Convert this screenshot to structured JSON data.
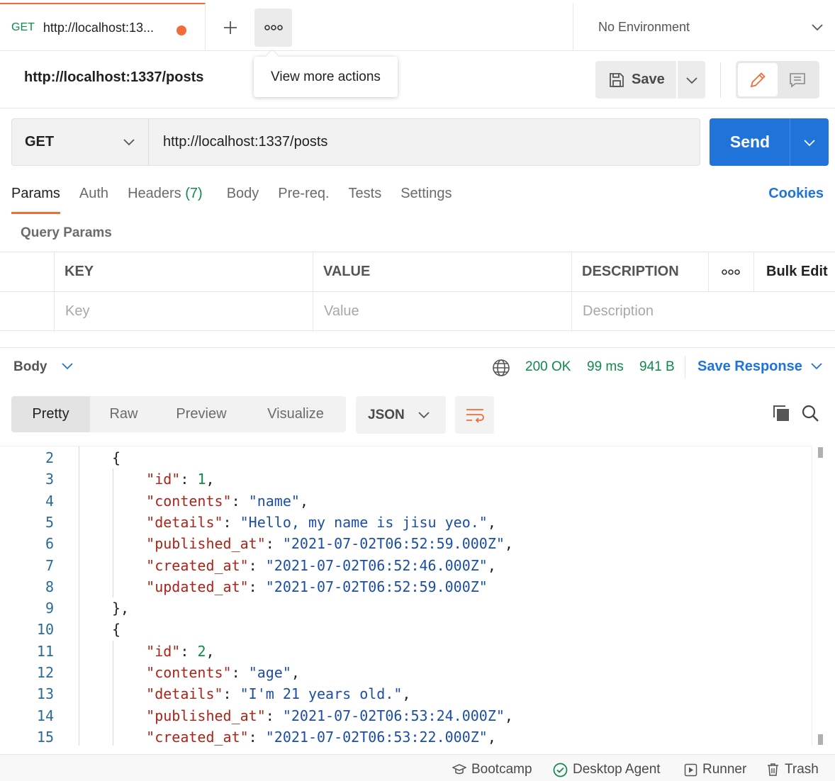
{
  "tabs": {
    "active_tab": {
      "method": "GET",
      "title": "http://localhost:13..."
    },
    "more_tooltip": "View more actions",
    "environment": "No Environment"
  },
  "request": {
    "name": "http://localhost:1337/posts",
    "save_label": "Save",
    "method": "GET",
    "url": "http://localhost:1337/posts",
    "send_label": "Send"
  },
  "request_tabs": {
    "items": [
      {
        "label": "Params"
      },
      {
        "label": "Auth"
      },
      {
        "label": "Headers",
        "count": "(7)"
      },
      {
        "label": "Body"
      },
      {
        "label": "Pre-req."
      },
      {
        "label": "Tests"
      },
      {
        "label": "Settings"
      }
    ],
    "cookies": "Cookies"
  },
  "query_params": {
    "title": "Query Params",
    "headers": {
      "key": "KEY",
      "value": "VALUE",
      "description": "DESCRIPTION",
      "bulk_edit": "Bulk Edit"
    },
    "placeholders": {
      "key": "Key",
      "value": "Value",
      "description": "Description"
    }
  },
  "response": {
    "body_label": "Body",
    "status": "200 OK",
    "time": "99 ms",
    "size": "941 B",
    "save_response": "Save Response",
    "format_tabs": [
      "Pretty",
      "Raw",
      "Preview",
      "Visualize"
    ],
    "language": "JSON"
  },
  "code_lines": [
    {
      "n": "2",
      "code": "{"
    },
    {
      "n": "3",
      "code": "    \"id\": 1,"
    },
    {
      "n": "4",
      "code": "    \"contents\": \"name\","
    },
    {
      "n": "5",
      "code": "    \"details\": \"Hello, my name is jisu yeo.\","
    },
    {
      "n": "6",
      "code": "    \"published_at\": \"2021-07-02T06:52:59.000Z\","
    },
    {
      "n": "7",
      "code": "    \"created_at\": \"2021-07-02T06:52:46.000Z\","
    },
    {
      "n": "8",
      "code": "    \"updated_at\": \"2021-07-02T06:52:59.000Z\""
    },
    {
      "n": "9",
      "code": "},"
    },
    {
      "n": "10",
      "code": "{"
    },
    {
      "n": "11",
      "code": "    \"id\": 2,"
    },
    {
      "n": "12",
      "code": "    \"contents\": \"age\","
    },
    {
      "n": "13",
      "code": "    \"details\": \"I'm 21 years old.\","
    },
    {
      "n": "14",
      "code": "    \"published_at\": \"2021-07-02T06:53:24.000Z\","
    },
    {
      "n": "15",
      "code": "    \"created_at\": \"2021-07-02T06:53:22.000Z\","
    }
  ],
  "status_bar": {
    "bootcamp": "Bootcamp",
    "desktop_agent": "Desktop Agent",
    "runner": "Runner",
    "trash": "Trash"
  },
  "colors": {
    "accent": "#f26b3a",
    "primary": "#1f73d9",
    "success": "#0f8a4a",
    "json_key": "#a8251a",
    "json_string": "#1c4ea6"
  }
}
